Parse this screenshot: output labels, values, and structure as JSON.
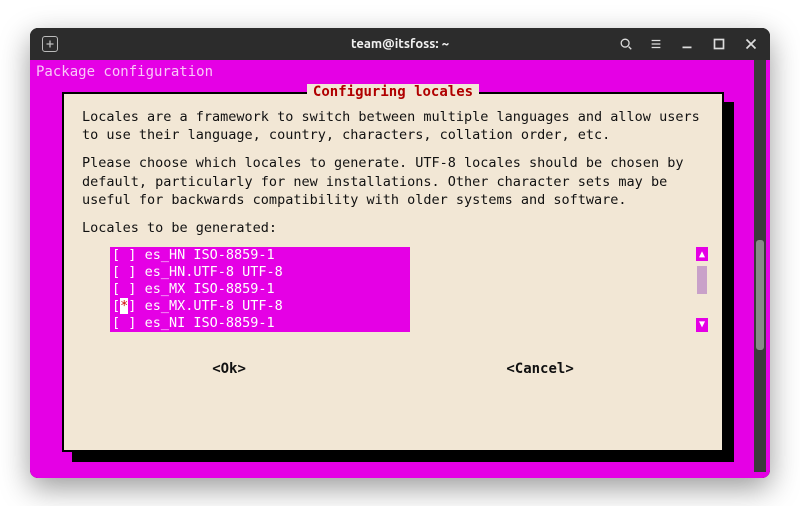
{
  "titlebar": {
    "title": "team@itsfoss: ~"
  },
  "header": "Package configuration",
  "dialog": {
    "title": "Configuring locales",
    "para1": "Locales are a framework to switch between multiple languages and allow users to use their language, country, characters, collation order, etc.",
    "para2": "Please choose which locales to generate. UTF-8 locales should be chosen by default, particularly for new installations. Other character sets may be useful for backwards compatibility with older systems and software.",
    "prompt": "Locales to be generated:",
    "items": [
      {
        "checked": " ",
        "mark": " ",
        "label": "es_HN ISO-8859-1"
      },
      {
        "checked": " ",
        "mark": " ",
        "label": "es_HN.UTF-8 UTF-8"
      },
      {
        "checked": " ",
        "mark": " ",
        "label": "es_MX ISO-8859-1"
      },
      {
        "checked": " ",
        "mark": "*",
        "label": "es_MX.UTF-8 UTF-8"
      },
      {
        "checked": " ",
        "mark": " ",
        "label": "es_NI ISO-8859-1"
      }
    ],
    "ok": "<Ok>",
    "cancel": "<Cancel>"
  }
}
